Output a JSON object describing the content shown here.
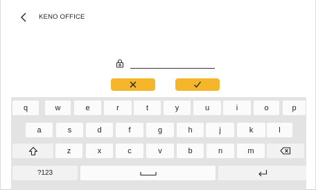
{
  "header": {
    "title": "KENO OFFICE",
    "back_icon": "chevron-left-icon"
  },
  "password": {
    "icon": "lock-icon",
    "value": ""
  },
  "actions": {
    "cancel_icon": "close-icon",
    "confirm_icon": "check-icon",
    "accent_color": "#f5b62c"
  },
  "keyboard": {
    "row1": [
      "q",
      "w",
      "e",
      "r",
      "t",
      "y",
      "u",
      "i",
      "o",
      "p"
    ],
    "row2": [
      "a",
      "s",
      "d",
      "f",
      "g",
      "h",
      "j",
      "k",
      "l"
    ],
    "row3": [
      "z",
      "x",
      "c",
      "v",
      "b",
      "n",
      "m"
    ],
    "shift_icon": "shift-icon",
    "backspace_icon": "backspace-icon",
    "symbols_label": "?123",
    "space_icon": "space-icon",
    "enter_icon": "enter-icon",
    "background_color": "#e3e3e3"
  }
}
